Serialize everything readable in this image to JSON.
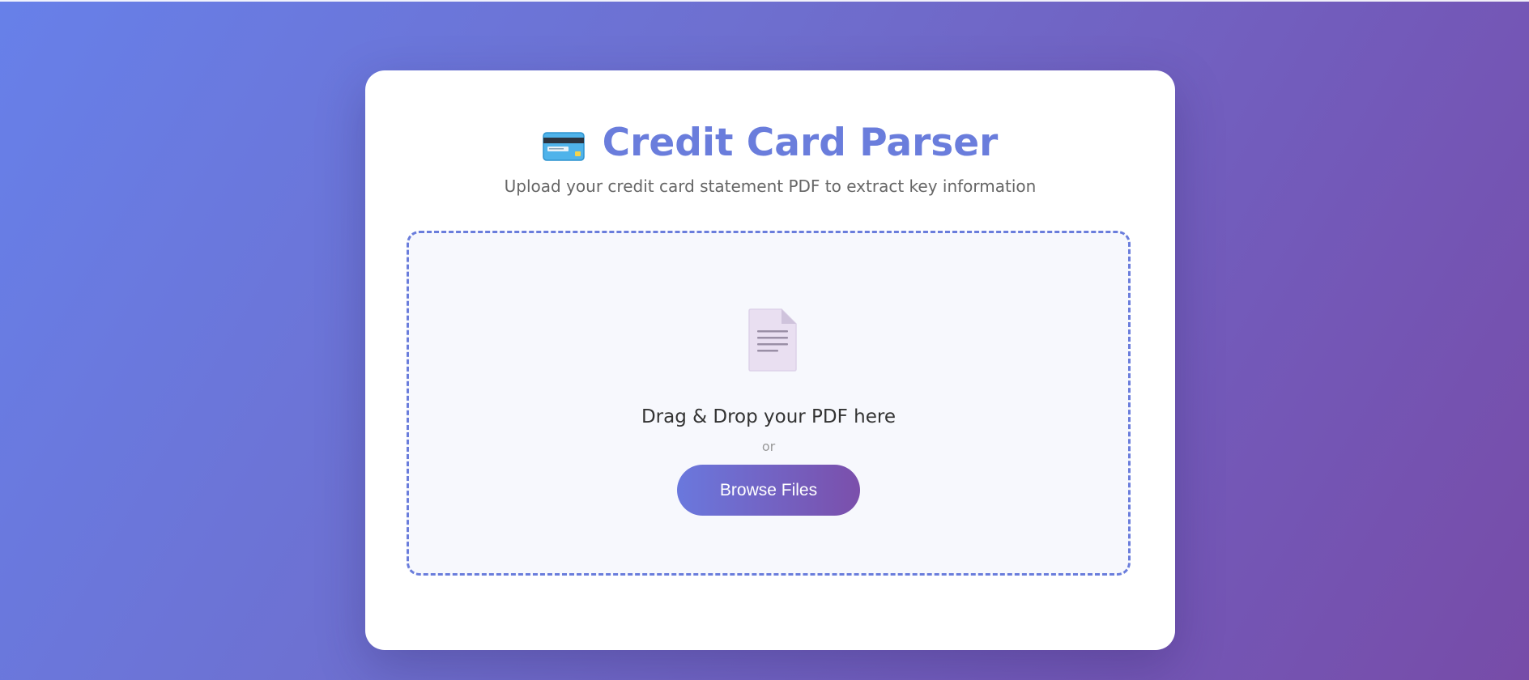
{
  "header": {
    "title": "Credit Card Parser",
    "title_icon": "credit-card-icon",
    "subtitle": "Upload your credit card statement PDF to extract key information"
  },
  "upload": {
    "icon": "document-icon",
    "drop_text": "Drag & Drop your PDF here",
    "or_text": "or",
    "browse_label": "Browse Files"
  },
  "colors": {
    "accent": "#6a7ddc",
    "gradient_start": "#6780e9",
    "gradient_end": "#774ca8"
  }
}
